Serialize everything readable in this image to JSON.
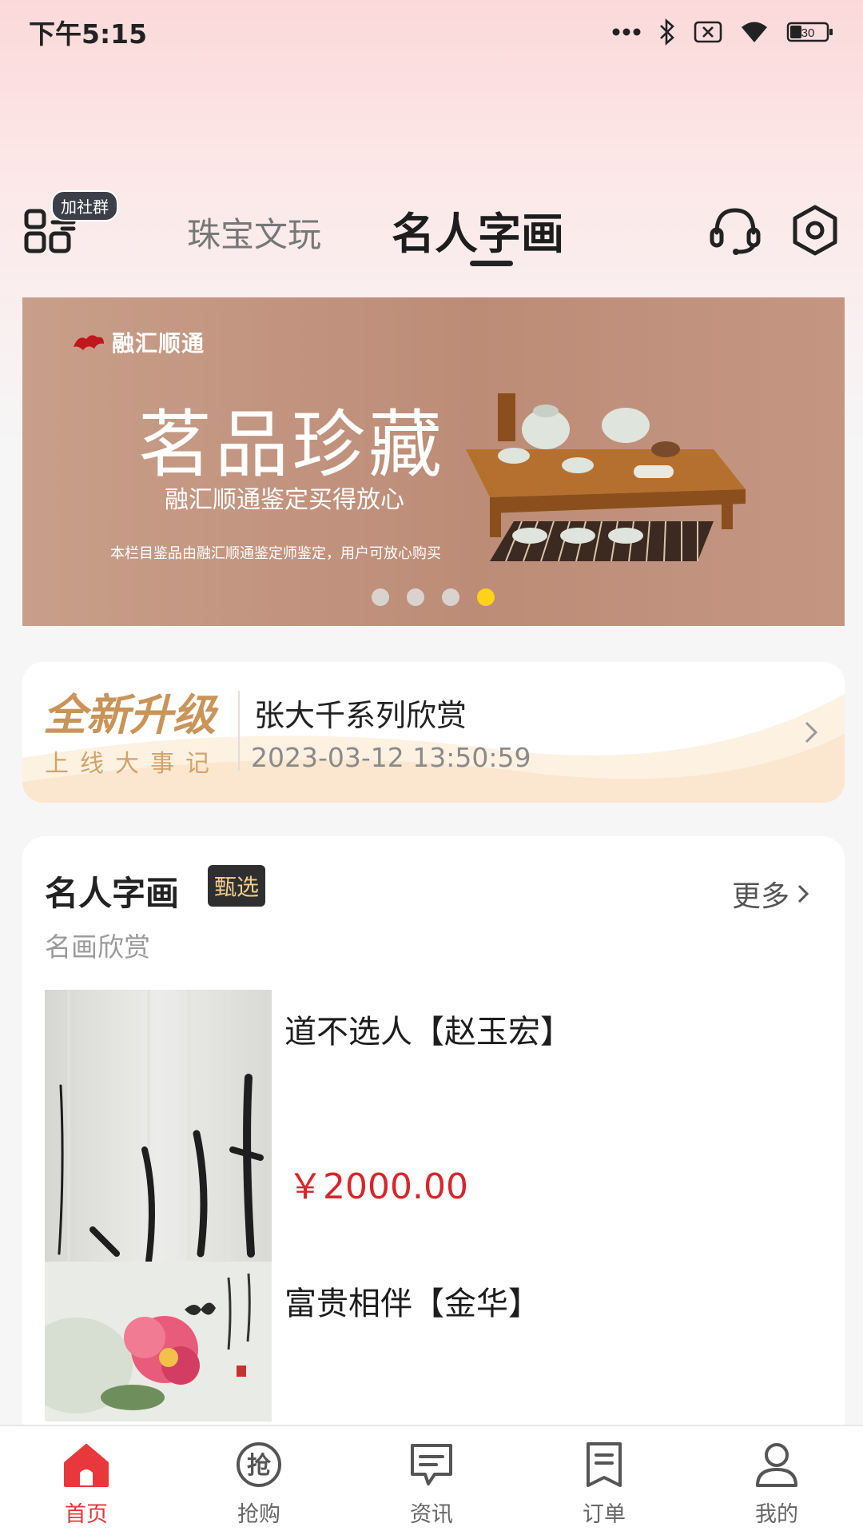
{
  "status_bar": {
    "time": "下午5:15",
    "battery": "30",
    "icons": [
      "more-dots-icon",
      "bluetooth-icon",
      "sim-icon",
      "wifi-icon",
      "battery-icon"
    ]
  },
  "header": {
    "group_badge": "加社群",
    "tabs": [
      {
        "label": "珠宝文玩",
        "active": false
      },
      {
        "label": "名人字画",
        "active": true
      }
    ],
    "icons": [
      "qr-code-icon",
      "headset-icon",
      "settings-icon"
    ]
  },
  "banner": {
    "brand": "融汇顺通",
    "title": "茗品珍藏",
    "subtitle": "融汇顺通鉴定买得放心",
    "note": "本栏目鉴品由融汇顺通鉴定师鉴定，用户可放心购买",
    "slides_total": 4,
    "active_slide": 4,
    "colors": {
      "active_dot": "#ffd11a",
      "inactive_dot": "#d9d3d0"
    }
  },
  "news": {
    "logo_top": "全新升级",
    "logo_bottom": "上线大事记",
    "title": "张大千系列欣赏",
    "time": "2023-03-12 13:50:59"
  },
  "section": {
    "title": "名人字画",
    "badge": "甄选",
    "more": "更多",
    "subtitle": "名画欣赏",
    "products": [
      {
        "name": "道不选人【赵玉宏】",
        "price": "￥2000.00"
      },
      {
        "name": "富贵相伴【金华】",
        "price": ""
      }
    ]
  },
  "tabbar": {
    "items": [
      {
        "label": "首页",
        "icon": "home-icon",
        "active": true
      },
      {
        "label": "抢购",
        "icon": "flash-sale-icon",
        "active": false
      },
      {
        "label": "资讯",
        "icon": "news-icon",
        "active": false
      },
      {
        "label": "订单",
        "icon": "orders-icon",
        "active": false
      },
      {
        "label": "我的",
        "icon": "profile-icon",
        "active": false
      }
    ],
    "colors": {
      "active": "#e2363a",
      "inactive": "#666666"
    }
  }
}
